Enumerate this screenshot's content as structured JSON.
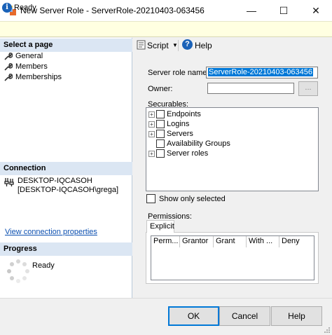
{
  "window": {
    "title": "New Server Role - ServerRole-20210403-063456",
    "minimize_glyph": "—",
    "maximize_glyph": "☐",
    "close_glyph": "✕"
  },
  "status": {
    "text": "Ready",
    "icon": "info-icon"
  },
  "left": {
    "select_page_header": "Select a page",
    "pages": [
      {
        "label": "General",
        "icon": "wrench-icon"
      },
      {
        "label": "Members",
        "icon": "wrench-icon"
      },
      {
        "label": "Memberships",
        "icon": "wrench-icon"
      }
    ],
    "connection_header": "Connection",
    "connection_server": "DESKTOP-IQCASOH",
    "connection_user": "[DESKTOP-IQCASOH\\grega]",
    "view_connection_link": "View connection properties",
    "progress_header": "Progress",
    "progress_status": "Ready"
  },
  "toolbar": {
    "script_label": "Script",
    "help_label": "Help"
  },
  "form": {
    "role_name_label": "Server role name:",
    "role_name_value": "ServerRole-20210403-063456",
    "owner_label": "Owner:",
    "owner_value": "",
    "browse_label": "...",
    "securables_label": "Securables:",
    "securables": [
      {
        "label": "Endpoints",
        "expandable": true
      },
      {
        "label": "Logins",
        "expandable": true
      },
      {
        "label": "Servers",
        "expandable": true
      },
      {
        "label": "Availability Groups",
        "expandable": false
      },
      {
        "label": "Server roles",
        "expandable": true
      }
    ],
    "show_only_selected_label": "Show only selected",
    "permissions_label": "Permissions:",
    "permissions_tab": "Explicit",
    "permissions_columns": [
      "Perm...",
      "Grantor",
      "Grant",
      "With ...",
      "Deny"
    ]
  },
  "buttons": {
    "ok": "OK",
    "cancel": "Cancel",
    "help": "Help"
  },
  "colors": {
    "accent": "#0078d7",
    "section_header": "#dbe6f3",
    "status_bg": "#ffffe1",
    "link": "#0b4fb0"
  }
}
